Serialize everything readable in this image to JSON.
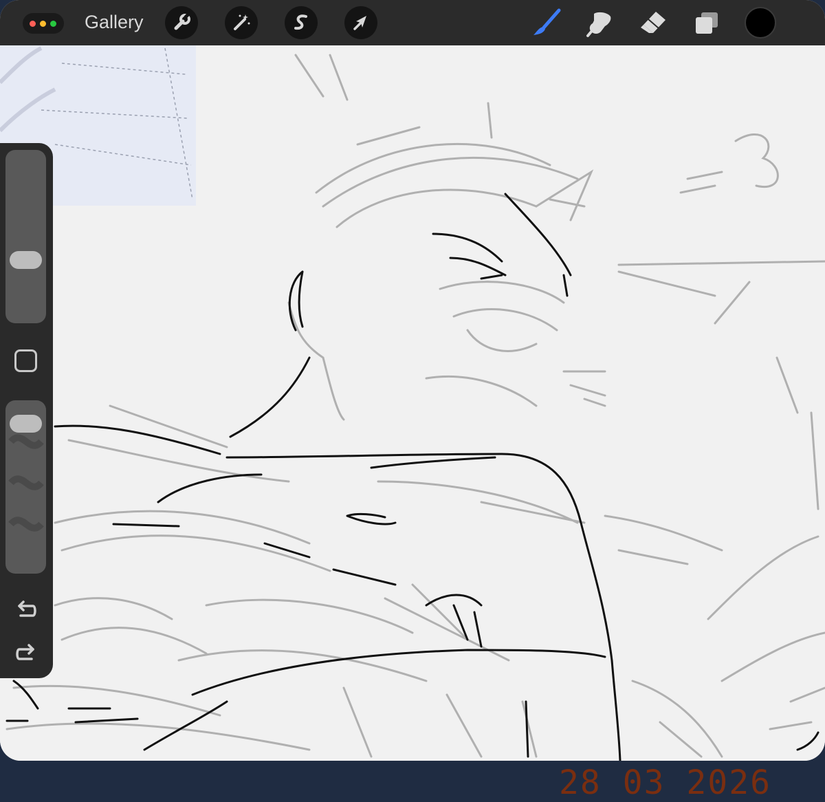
{
  "app": {
    "window_controls": [
      "close",
      "minimize",
      "zoom"
    ]
  },
  "topbar": {
    "gallery_label": "Gallery",
    "left_tools": [
      {
        "name": "actions",
        "icon": "wrench-icon"
      },
      {
        "name": "adjustments",
        "icon": "magic-wand-icon"
      },
      {
        "name": "selection",
        "icon": "selection-s-icon"
      },
      {
        "name": "transform",
        "icon": "arrow-cursor-icon"
      }
    ],
    "right_tools": [
      {
        "name": "brush",
        "icon": "brush-icon",
        "active": true
      },
      {
        "name": "smudge",
        "icon": "smudge-icon",
        "active": false
      },
      {
        "name": "eraser",
        "icon": "eraser-icon",
        "active": false
      },
      {
        "name": "layers",
        "icon": "layers-icon",
        "active": false
      }
    ],
    "current_color": "#000000"
  },
  "sidebar": {
    "brush_size_level": 0.34,
    "opacity_level": 0.93,
    "buttons": [
      "modify-square",
      "undo",
      "redo"
    ]
  },
  "canvas": {
    "background": "#f1f1f1",
    "reference_panel_color": "#e6eaf5"
  },
  "colors": {
    "accent": "#3d7bf5",
    "toolbar": "#2b2b2b",
    "sidebar": "#2a2a2a",
    "stamp": "#7a2e10"
  },
  "date_stamp": "28 03 2026"
}
